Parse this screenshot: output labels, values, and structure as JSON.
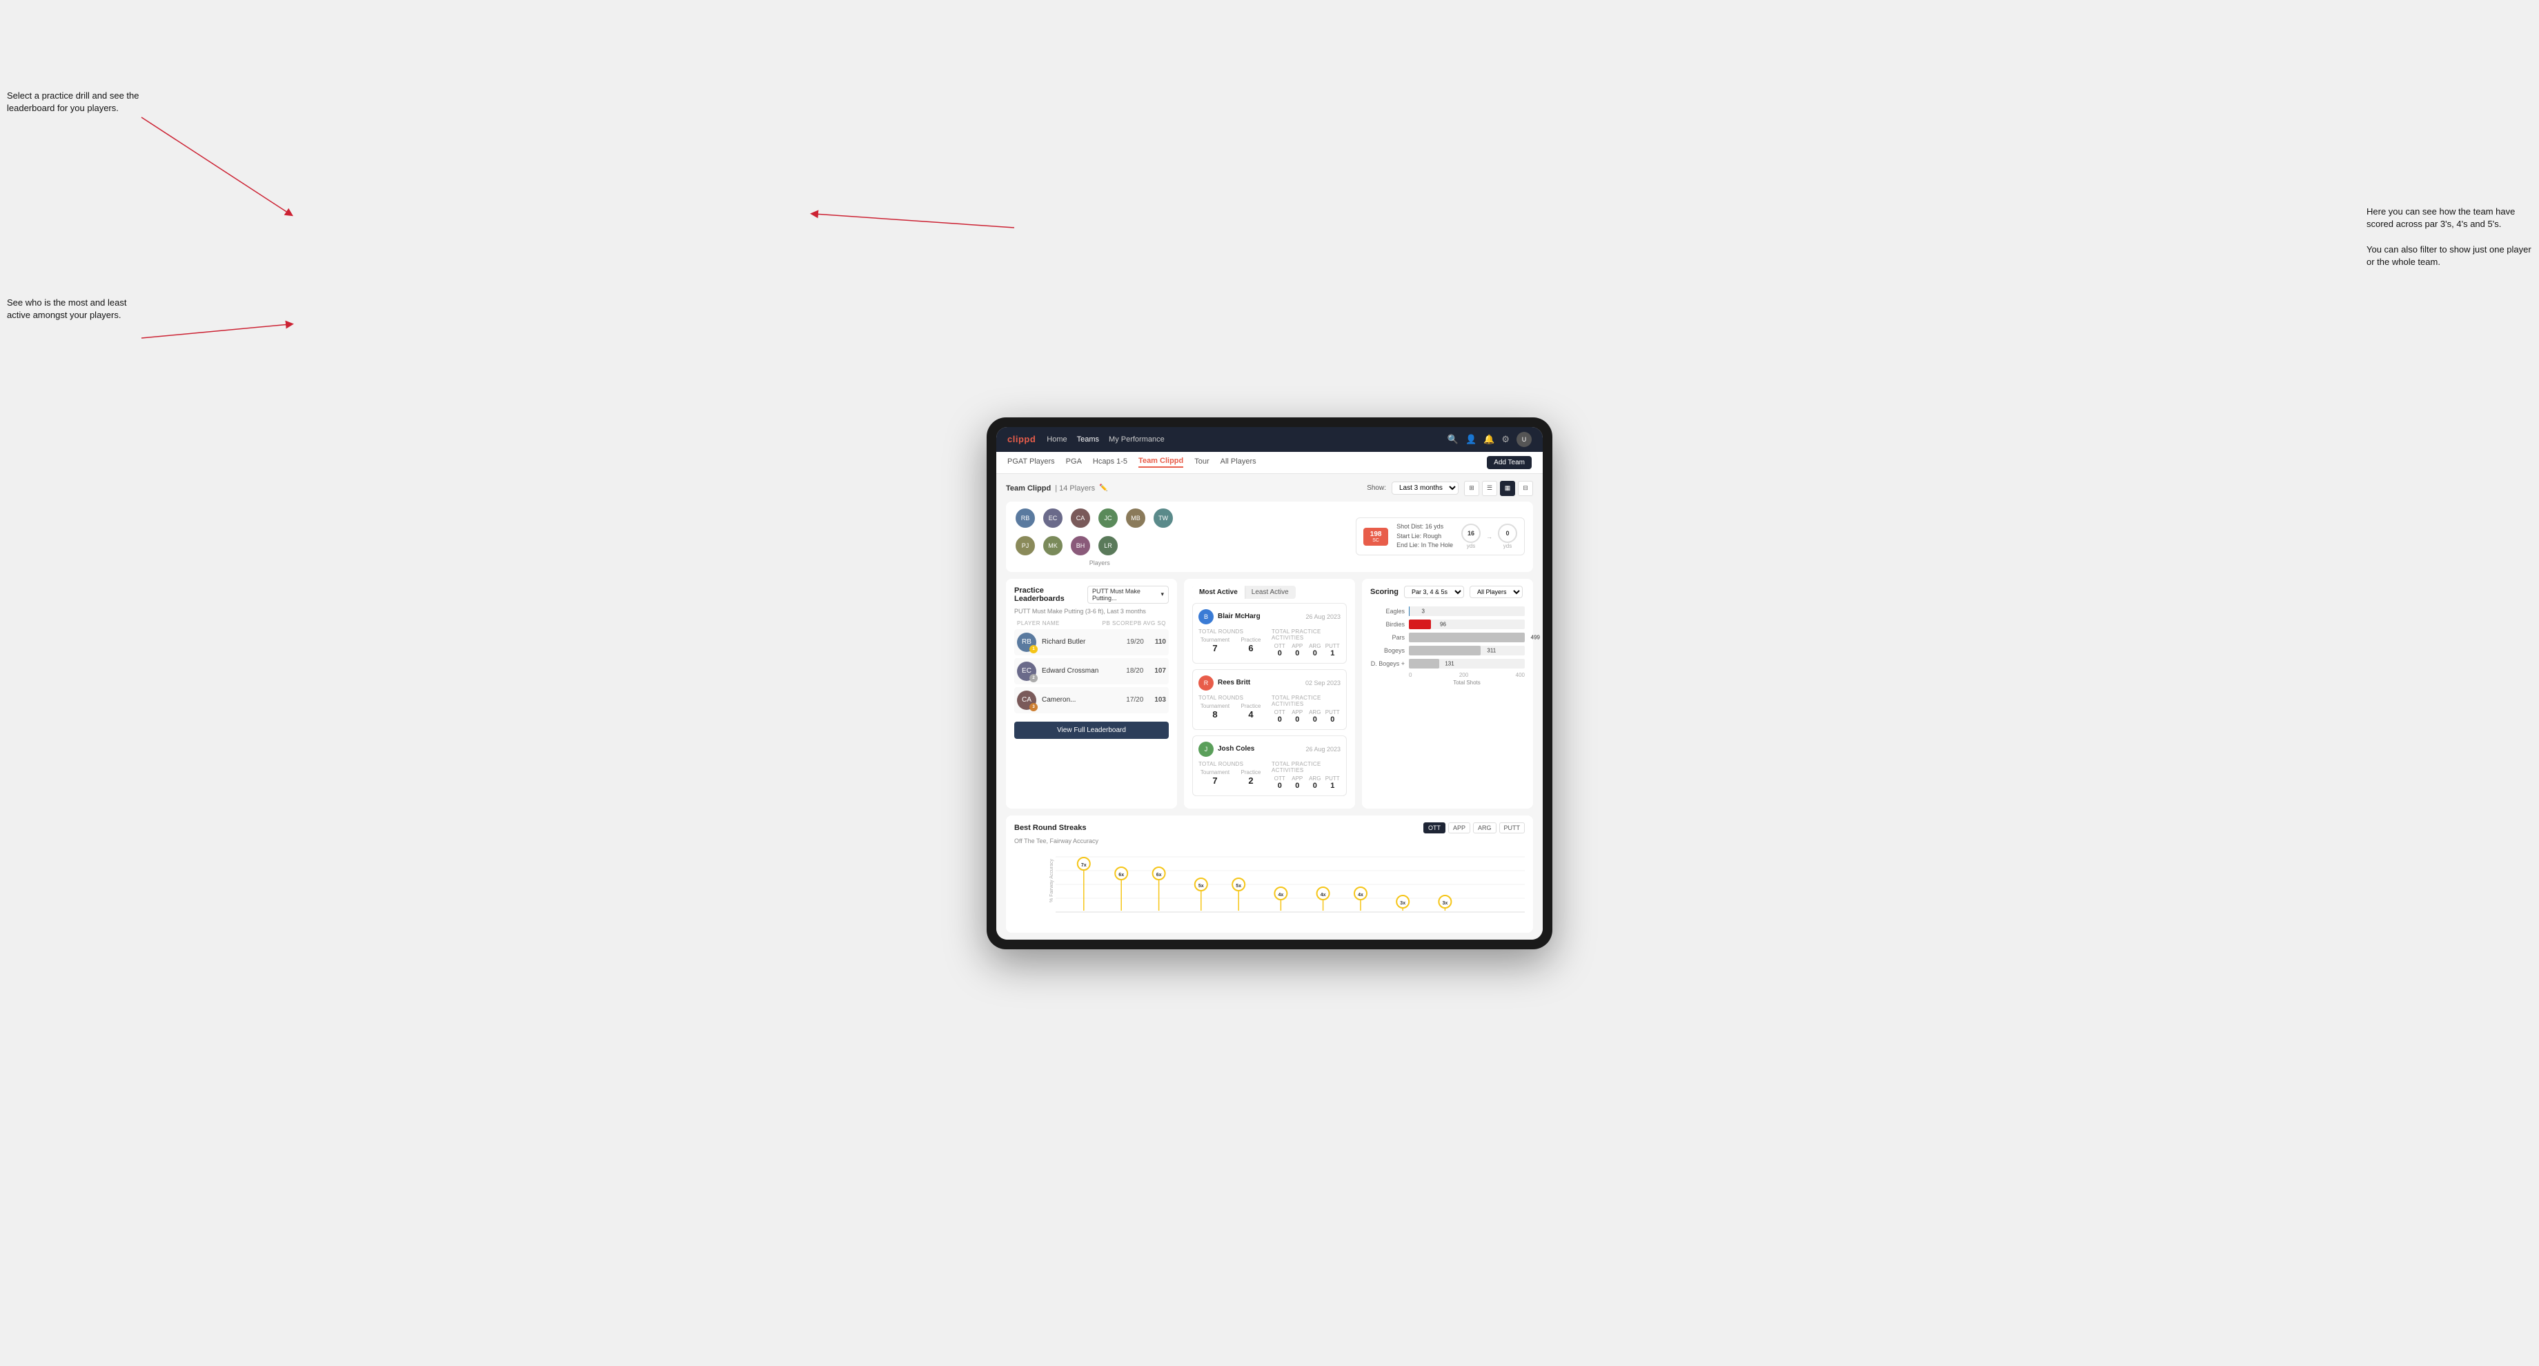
{
  "annotations": {
    "top_left": "Select a practice drill and see the leaderboard for you players.",
    "bottom_left": "See who is the most and least active amongst your players.",
    "top_right": "Here you can see how the team have scored across par 3's, 4's and 5's.\n\nYou can also filter to show just one player or the whole team."
  },
  "navbar": {
    "brand": "clippd",
    "links": [
      "Home",
      "Teams",
      "My Performance"
    ],
    "active_link": "Teams"
  },
  "subnav": {
    "items": [
      "PGAT Players",
      "PGA",
      "Hcaps 1-5",
      "Team Clippd",
      "Tour",
      "All Players"
    ],
    "active_item": "Team Clippd",
    "add_team_label": "Add Team"
  },
  "team_header": {
    "title": "Team Clippd",
    "count": "14 Players",
    "show_label": "Show:",
    "show_value": "Last 3 months"
  },
  "players": [
    {
      "initials": "RB",
      "color": "#5a7a9f"
    },
    {
      "initials": "EC",
      "color": "#7a5a9f"
    },
    {
      "initials": "CA",
      "color": "#9f5a5a"
    },
    {
      "initials": "JC",
      "color": "#5a9f7a"
    },
    {
      "initials": "MB",
      "color": "#9f7a5a"
    },
    {
      "initials": "TW",
      "color": "#5a9f9f"
    },
    {
      "initials": "PJ",
      "color": "#9f9f5a"
    },
    {
      "initials": "MK",
      "color": "#7a9f5a"
    },
    {
      "initials": "BH",
      "color": "#9f5a7a"
    },
    {
      "initials": "LR",
      "color": "#5a7a5a"
    }
  ],
  "players_label": "Players",
  "shot_stat": {
    "badge": "198",
    "badge_sub": "SC",
    "details_line1": "Shot Dist: 16 yds",
    "details_line2": "Start Lie: Rough",
    "details_line3": "End Lie: In The Hole",
    "circle1_val": "16",
    "circle1_label": "yds",
    "circle2_val": "0",
    "circle2_label": "yds"
  },
  "practice_leaderboards": {
    "title": "Practice Leaderboards",
    "drill_label": "PUTT Must Make Putting...",
    "subtitle": "PUTT Must Make Putting (3-6 ft), Last 3 months",
    "table_headers": [
      "PLAYER NAME",
      "PB SCORE",
      "PB AVG SQ"
    ],
    "rows": [
      {
        "name": "Richard Butler",
        "score": "19/20",
        "avg": "110",
        "badge_type": "gold",
        "badge_num": "1"
      },
      {
        "name": "Edward Crossman",
        "score": "18/20",
        "avg": "107",
        "badge_type": "silver",
        "badge_num": "2"
      },
      {
        "name": "Cameron...",
        "score": "17/20",
        "avg": "103",
        "badge_type": "bronze",
        "badge_num": "3"
      }
    ],
    "view_full_label": "View Full Leaderboard"
  },
  "activity": {
    "toggle_options": [
      "Most Active",
      "Least Active"
    ],
    "active_toggle": "Most Active",
    "cards": [
      {
        "name": "Blair McHarg",
        "date": "26 Aug 2023",
        "total_rounds_label": "Total Rounds",
        "tournament_label": "Tournament",
        "practice_label": "Practice",
        "tournament_val": "7",
        "practice_val": "6",
        "total_practice_label": "Total Practice Activities",
        "ott_label": "OTT",
        "app_label": "APP",
        "arg_label": "ARG",
        "putt_label": "PUTT",
        "ott_val": "0",
        "app_val": "0",
        "arg_val": "0",
        "putt_val": "1"
      },
      {
        "name": "Rees Britt",
        "date": "02 Sep 2023",
        "tournament_val": "8",
        "practice_val": "4",
        "ott_val": "0",
        "app_val": "0",
        "arg_val": "0",
        "putt_val": "0"
      },
      {
        "name": "Josh Coles",
        "date": "26 Aug 2023",
        "tournament_val": "7",
        "practice_val": "2",
        "ott_val": "0",
        "app_val": "0",
        "arg_val": "0",
        "putt_val": "1"
      }
    ]
  },
  "scoring": {
    "title": "Scoring",
    "filter1": "Par 3, 4 & 5s",
    "filter2": "All Players",
    "bars": [
      {
        "label": "Eagles",
        "value": 3,
        "max": 499,
        "color": "#2c7bb6"
      },
      {
        "label": "Birdies",
        "value": 96,
        "max": 499,
        "color": "#d7191c"
      },
      {
        "label": "Pars",
        "value": 499,
        "max": 499,
        "color": "#c0c0c0"
      },
      {
        "label": "Bogeys",
        "value": 311,
        "max": 499,
        "color": "#c0c0c0"
      },
      {
        "label": "D. Bogeys +",
        "value": 131,
        "max": 499,
        "color": "#c0c0c0"
      }
    ],
    "x_axis": [
      "0",
      "200",
      "400"
    ],
    "x_label": "Total Shots"
  },
  "best_round_streaks": {
    "title": "Best Round Streaks",
    "subtitle": "Off The Tee, Fairway Accuracy",
    "buttons": [
      "OTT",
      "APP",
      "ARG",
      "PUTT"
    ],
    "active_button": "OTT",
    "y_axis_label": "% Fairway Accuracy",
    "dots": [
      {
        "x_pct": 6,
        "y_pct": 85,
        "line_h": 65,
        "label": "7x"
      },
      {
        "x_pct": 14,
        "y_pct": 72,
        "line_h": 52,
        "label": "6x"
      },
      {
        "x_pct": 22,
        "y_pct": 72,
        "line_h": 52,
        "label": "6x"
      },
      {
        "x_pct": 30,
        "y_pct": 58,
        "line_h": 38,
        "label": "5x"
      },
      {
        "x_pct": 38,
        "y_pct": 58,
        "line_h": 38,
        "label": "5x"
      },
      {
        "x_pct": 47,
        "y_pct": 44,
        "line_h": 24,
        "label": "4x"
      },
      {
        "x_pct": 55,
        "y_pct": 44,
        "line_h": 24,
        "label": "4x"
      },
      {
        "x_pct": 63,
        "y_pct": 44,
        "line_h": 24,
        "label": "4x"
      },
      {
        "x_pct": 72,
        "y_pct": 30,
        "line_h": 12,
        "label": "3x"
      },
      {
        "x_pct": 80,
        "y_pct": 30,
        "line_h": 12,
        "label": "3x"
      }
    ]
  }
}
